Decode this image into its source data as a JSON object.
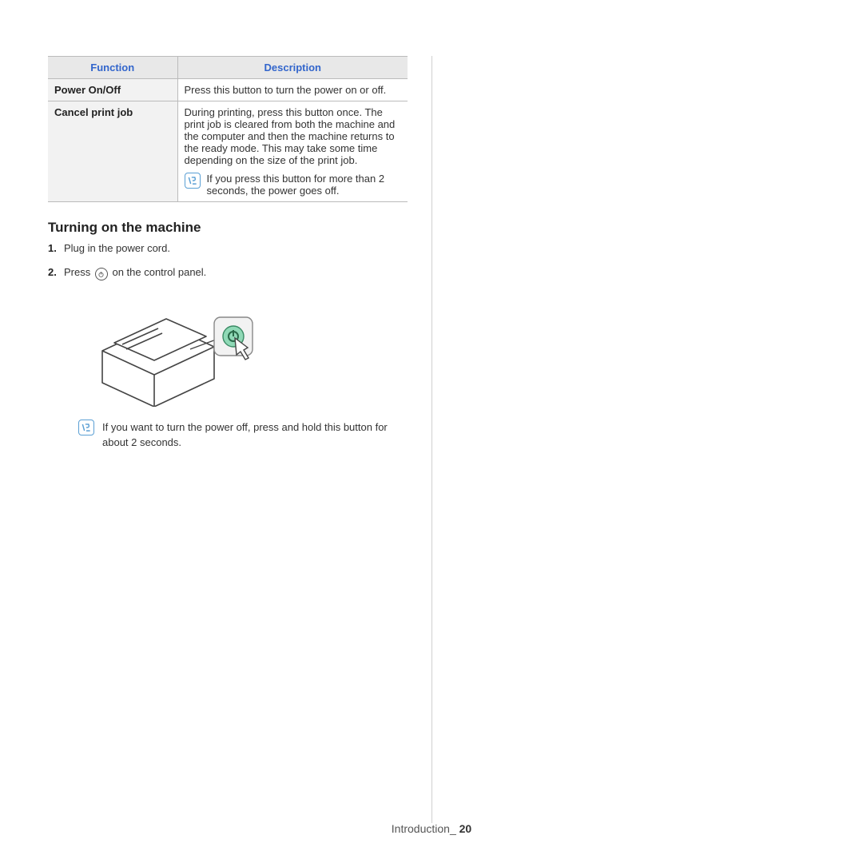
{
  "table": {
    "headers": {
      "c1": "Function",
      "c2": "Description"
    },
    "rows": [
      {
        "fn": "Power On/Off",
        "desc": "Press this button to turn the power on or off."
      },
      {
        "fn": "Cancel print job",
        "desc": "During printing, press this button once. The print job is cleared from both the machine and the computer and then the machine returns to the ready mode. This may take some time depending on the size of the print job.",
        "note": "If you press this button for more than 2 seconds, the power goes off."
      }
    ]
  },
  "section_title": "Turning on the machine",
  "steps": {
    "s1": "Plug in the power cord.",
    "s2a": "Press ",
    "s2b": " on the control panel."
  },
  "footnote": "If you want to turn the power off, press and hold this button for about 2 seconds.",
  "footer": {
    "chapter": "Introduction_",
    "page": "20"
  }
}
